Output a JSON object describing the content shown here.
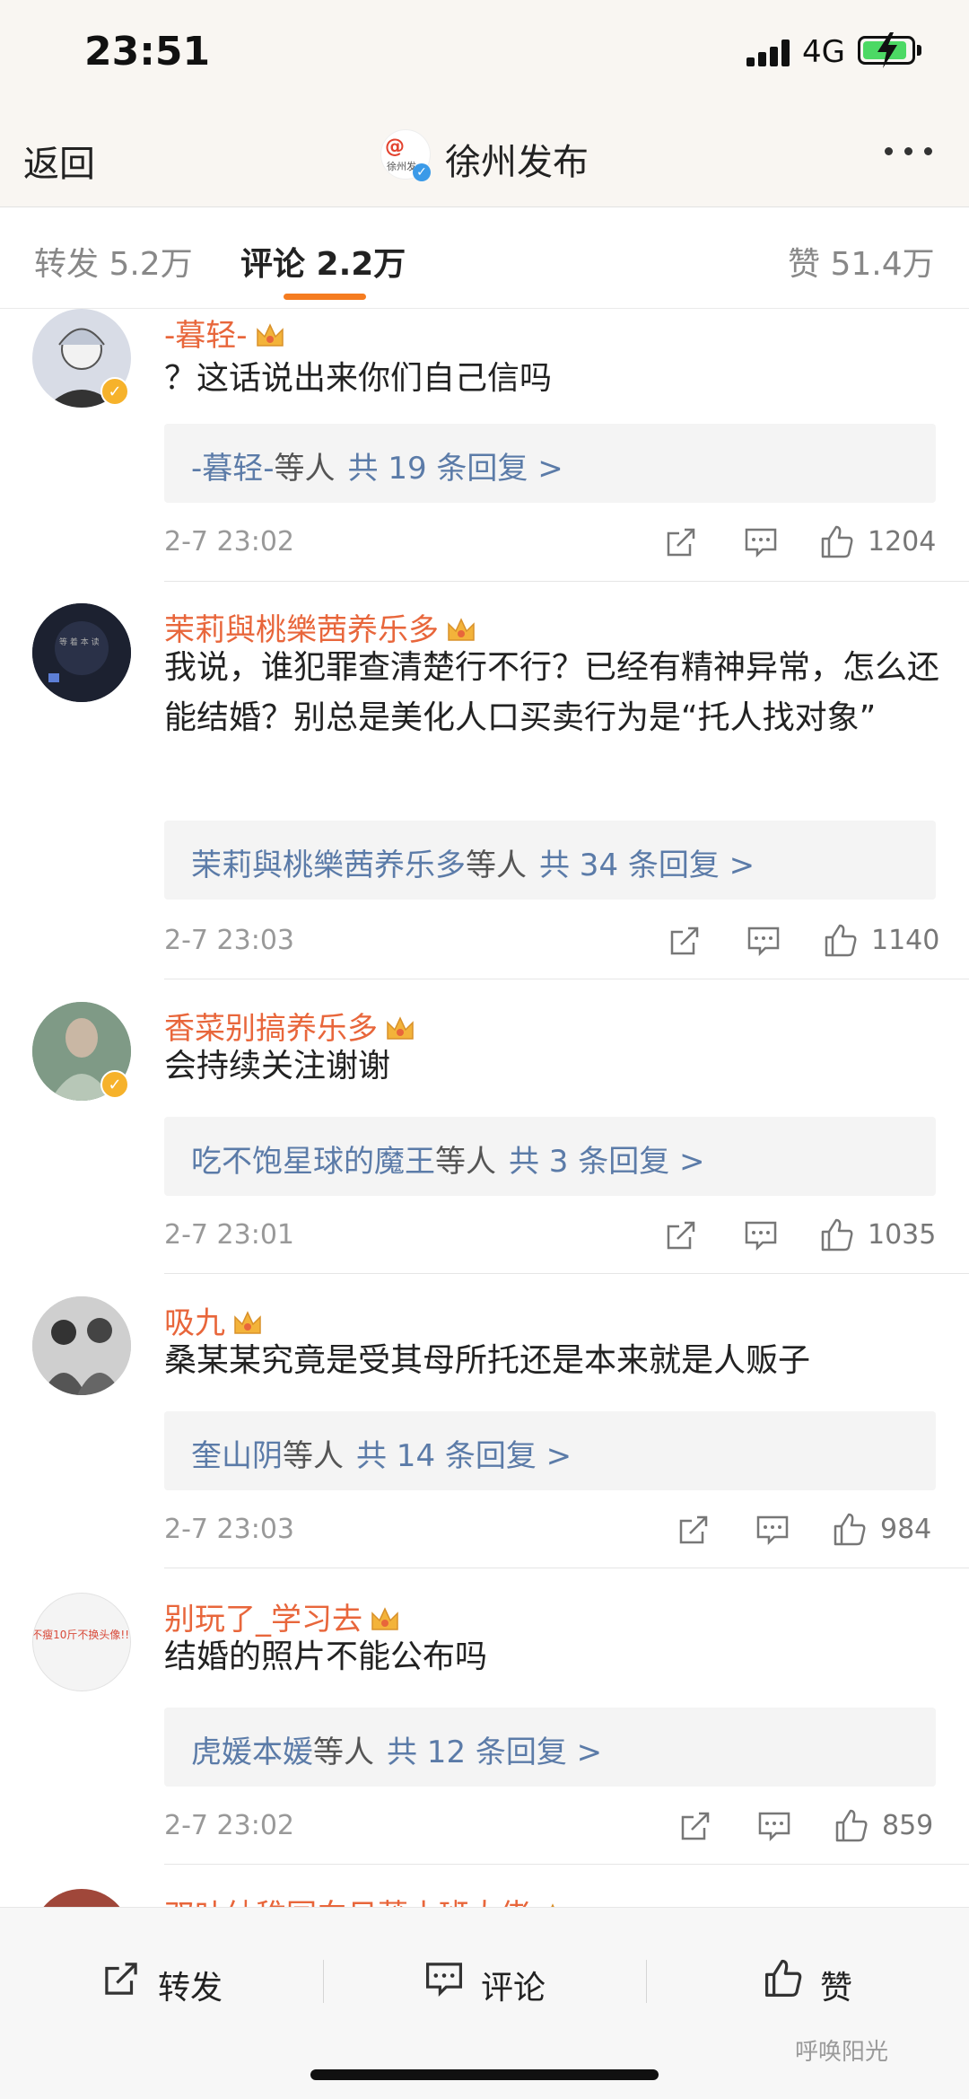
{
  "status_bar": {
    "time": "23:51",
    "network": "4G"
  },
  "header": {
    "back_label": "返回",
    "account_name": "徐州发布",
    "logo_text": "徐州发"
  },
  "tabs": [
    {
      "label": "转发 5.2万",
      "active": false
    },
    {
      "label": "评论 2.2万",
      "active": true
    },
    {
      "label": "赞 51.4万",
      "active": false
    }
  ],
  "comments": [
    {
      "username": "-暮轻-",
      "verified": true,
      "text": "？这话说出来你们自己信吗",
      "reply_name": "-暮轻-",
      "reply_suffix": "等人",
      "reply_count": "共 19 条回复 >",
      "time": "2-7 23:02",
      "likes": "1204"
    },
    {
      "username": "茉莉與桃樂茜养乐多",
      "verified": false,
      "text": "我说，谁犯罪查清楚行不行？已经有精神异常，怎么还能结婚？别总是美化人口买卖行为是“托人找对象”",
      "reply_name": "茉莉與桃樂茜养乐多",
      "reply_suffix": "等人",
      "reply_count": "共 34 条回复 >",
      "time": "2-7 23:03",
      "likes": "1140"
    },
    {
      "username": "香菜别搞养乐多",
      "verified": true,
      "text": "会持续关注谢谢",
      "reply_name": "吃不饱星球的魔王",
      "reply_suffix": "等人",
      "reply_count": "共 3 条回复 >",
      "time": "2-7 23:01",
      "likes": "1035"
    },
    {
      "username": "吸九",
      "verified": false,
      "text": "桑某某究竟是受其母所托还是本来就是人贩子",
      "reply_name": "奎山阴",
      "reply_suffix": "等人",
      "reply_count": "共 14 条回复 >",
      "time": "2-7 23:03",
      "likes": "984"
    },
    {
      "username": "别玩了_学习去",
      "verified": false,
      "text": "结婚的照片不能公布吗",
      "reply_name": "虎媛本媛",
      "reply_suffix": "等人",
      "reply_count": "共 12 条回复 >",
      "time": "2-7 23:02",
      "likes": "859",
      "avatar_text": "不瘦10斤不换头像!!!"
    },
    {
      "username": "双叶幼稚园向日葵小班大佬",
      "verified": false
    }
  ],
  "bottom_bar": {
    "repost": "转发",
    "comment": "评论",
    "like": "赞"
  },
  "watermark": "呼唤阳光",
  "colors": {
    "accent": "#f57c20",
    "username": "#e8663b",
    "link": "#5b7ba8",
    "verified": "#3b9ae8",
    "vip": "#f6b22b"
  },
  "icons": [
    "share-icon",
    "comment-icon",
    "like-icon",
    "crown-icon",
    "verified-icon"
  ]
}
